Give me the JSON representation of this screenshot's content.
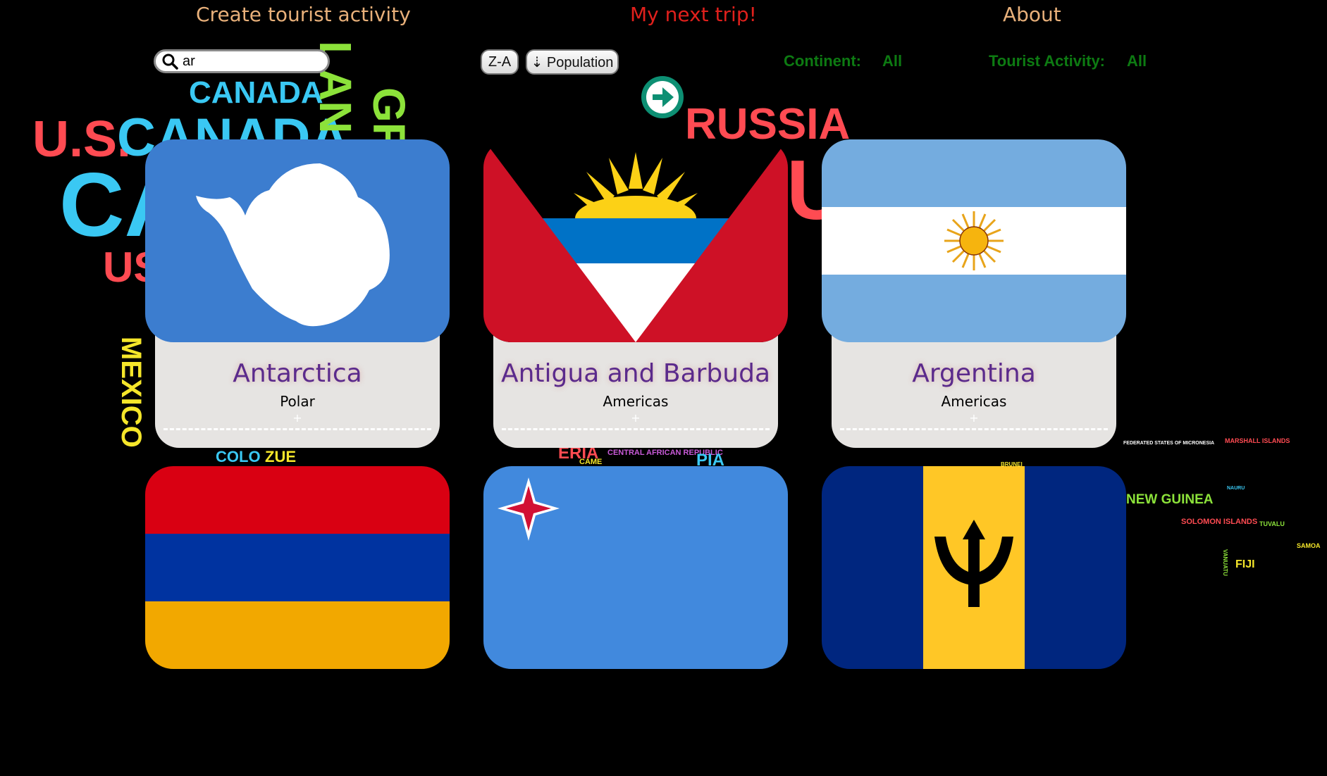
{
  "nav": {
    "create": "Create tourist activity",
    "next_trip": "My next trip!",
    "about": "About"
  },
  "search": {
    "value": "ar",
    "placeholder": ""
  },
  "sort": {
    "alpha": "Z-A",
    "population": "⇣ Population"
  },
  "filters": {
    "continent_label": "Continent:",
    "continent_value": "All",
    "activity_label": "Tourist Activity:",
    "activity_value": "All"
  },
  "background_words": [
    "U.S.",
    "CANADA",
    "CANADA",
    "CA",
    "GRE",
    "LAN",
    "RUSSIA",
    "MEXICO",
    "US",
    "U",
    "NEW GUINEA",
    "SOLOMON ISLANDS",
    "FIJI",
    "TUVALU",
    "SAMOA",
    "MARSHALL ISLANDS",
    "FEDERATED STATES OF MICRONESIA",
    "BRUNEI",
    "NAURU",
    "VANUATU",
    "COLO",
    "ZUE",
    "CENTRAL AFRICAN REPUBLIC",
    "PIA",
    "ERIA",
    "CAME"
  ],
  "countries": [
    {
      "name": "Antarctica",
      "continent": "Polar",
      "flag": "antarctica-flag"
    },
    {
      "name": "Antigua and Barbuda",
      "continent": "Americas",
      "flag": "antigua-flag"
    },
    {
      "name": "Argentina",
      "continent": "Americas",
      "flag": "argentina-flag"
    },
    {
      "name": "",
      "continent": "",
      "flag": "armenia-flag"
    },
    {
      "name": "",
      "continent": "",
      "flag": "australia-flag"
    },
    {
      "name": "",
      "continent": "",
      "flag": "barbados-flag"
    }
  ],
  "colors": {
    "nav": "#e8b07a",
    "nav_active": "#e0201c",
    "filter": "#0d7a12",
    "card_title": "#5b2a8c",
    "go_button": "#0d8f73"
  }
}
